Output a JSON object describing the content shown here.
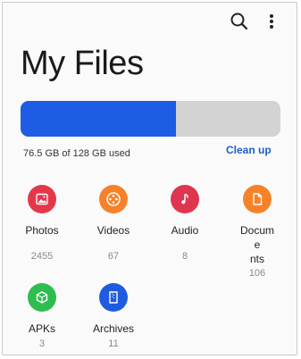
{
  "header": {
    "title": "My Files"
  },
  "toolbar": {
    "search_icon": "search-icon",
    "more_icon": "more-vert-icon"
  },
  "storage": {
    "used_text": "76.5 GB of 128 GB used",
    "used_fraction": 0.598,
    "clean_up_label": "Clean up",
    "bar_color": "#1f5ce6",
    "track_color": "#d3d3d3"
  },
  "categories": [
    {
      "label": "Photos",
      "count": "2455",
      "icon": "image-icon",
      "color": "#e5374a"
    },
    {
      "label": "Videos",
      "count": "67",
      "icon": "film-reel-icon",
      "color": "#f5822a"
    },
    {
      "label": "Audio",
      "count": "8",
      "icon": "music-note-icon",
      "color": "#e0354f"
    },
    {
      "label": "Documents",
      "label_line1": "Docume",
      "label_line2": "nts",
      "count": "106",
      "icon": "document-icon",
      "color": "#f5822a"
    },
    {
      "label": "APKs",
      "count": "3",
      "icon": "package-icon",
      "color": "#2ebd4f"
    },
    {
      "label": "Archives",
      "count": "11",
      "icon": "archive-icon",
      "color": "#1e5be0"
    }
  ]
}
